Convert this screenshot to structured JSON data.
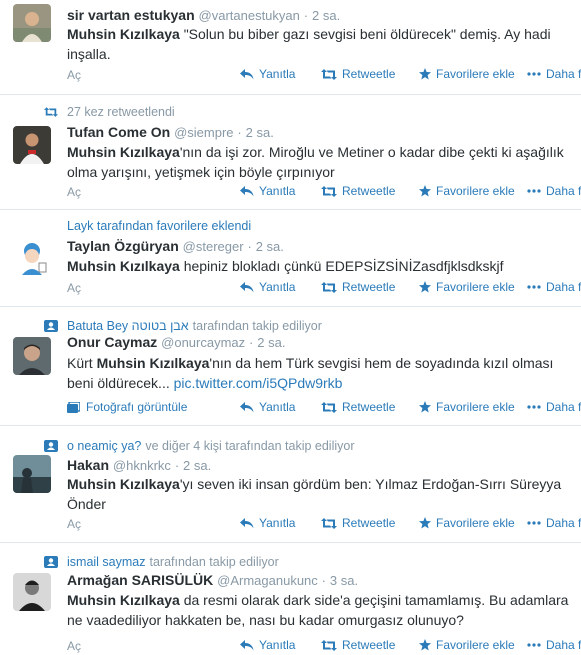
{
  "colors": {
    "link": "#2b7bb9",
    "meta": "#8899a6",
    "text": "#292f33",
    "divider": "#e1e8ed"
  },
  "actions": {
    "reply": "Yanıtla",
    "retweet": "Retweetle",
    "favorite": "Favorilere ekle",
    "more": "Daha fazla",
    "open": "Aç"
  },
  "tweets": [
    {
      "author": "sir vartan estukyan",
      "handle": "@vartanestukyan",
      "dot": "·",
      "time": "2 sa.",
      "mention": "Muhsin Kızılkaya",
      "text": "\"Solun bu biber gazı sevgisi beni öldürecek\" demiş. Ay hadi inşalla."
    },
    {
      "context_icon": "retweet-icon",
      "context_text": "27 kez retweetlendi",
      "author": "Tufan Come On",
      "handle": "@siempre",
      "dot": "·",
      "time": "2 sa.",
      "mention": "Muhsin Kızılkaya",
      "text": "'nın da işi zor. Miroğlu ve Metiner o kadar dibe çekti ki aşağılık olma yarışını, yetişmek için böyle çırpınıyor"
    },
    {
      "context_text": "Layk tarafından favorilere eklendi",
      "author": "Taylan Özgüryan",
      "handle": "@stereger",
      "dot": "·",
      "time": "2 sa.",
      "mention": "Muhsin Kızılkaya",
      "text": " hepiniz blokladı çünkü EDEPSİZSİNİZasdfjklsdkskjf"
    },
    {
      "context_icon": "follow-icon",
      "context_name": "Batuta Bey אבן בטוטה",
      "context_text": "tarafından takip ediliyor",
      "author": "Onur Caymaz",
      "handle": "@onurcaymaz",
      "dot": "·",
      "time": "2 sa.",
      "text_before": "Kürt ",
      "mention": "Muhsin Kızılkaya",
      "text": "'nın da hem Türk sevgisi hem de soyadında kızıl olması beni öldürecek... ",
      "link": "pic.twitter.com/i5QPdw9rkb",
      "photo_label": "Fotoğrafı görüntüle"
    },
    {
      "context_icon": "follow-icon",
      "context_name": "o neamiç ya?",
      "context_text": "ve diğer 4 kişi tarafından takip ediliyor",
      "author": "Hakan",
      "handle": "@hknkrkc",
      "dot": "·",
      "time": "2 sa.",
      "mention": "Muhsin Kızılkaya",
      "text": "'yı seven iki insan gördüm ben: Yılmaz Erdoğan-Sırrı Süreyya Önder"
    },
    {
      "context_icon": "follow-icon",
      "context_name": "ismail saymaz",
      "context_text": "tarafından takip ediliyor",
      "author": "Armağan SARISÜLÜK",
      "handle": "@Armaganukunc",
      "dot": "·",
      "time": "3 sa.",
      "mention": "Muhsin Kızılkaya",
      "text": " da resmi olarak dark side'a geçişini tamamlamış. Bu adamlara ne vaadediliyor hakkaten be, nası bu kadar omurgasız olunuyo?"
    }
  ]
}
